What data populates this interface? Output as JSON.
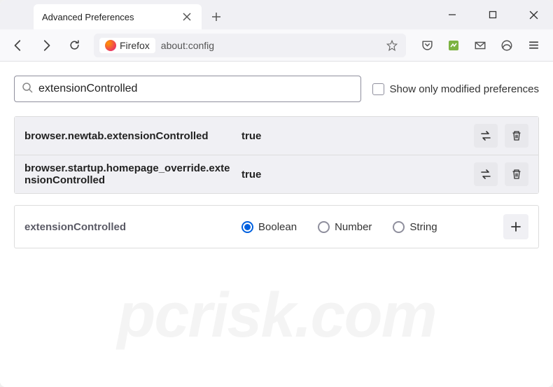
{
  "tab": {
    "title": "Advanced Preferences"
  },
  "toolbar": {
    "brand": "Firefox",
    "url": "about:config"
  },
  "search": {
    "value": "extensionControlled",
    "checkbox_label": "Show only modified preferences"
  },
  "prefs": [
    {
      "name": "browser.newtab.extensionControlled",
      "value": "true"
    },
    {
      "name": "browser.startup.homepage_override.extensionControlled",
      "value": "true"
    }
  ],
  "create": {
    "name": "extensionControlled",
    "types": [
      "Boolean",
      "Number",
      "String"
    ],
    "selected": "Boolean"
  },
  "watermark": "pcrisk.com"
}
